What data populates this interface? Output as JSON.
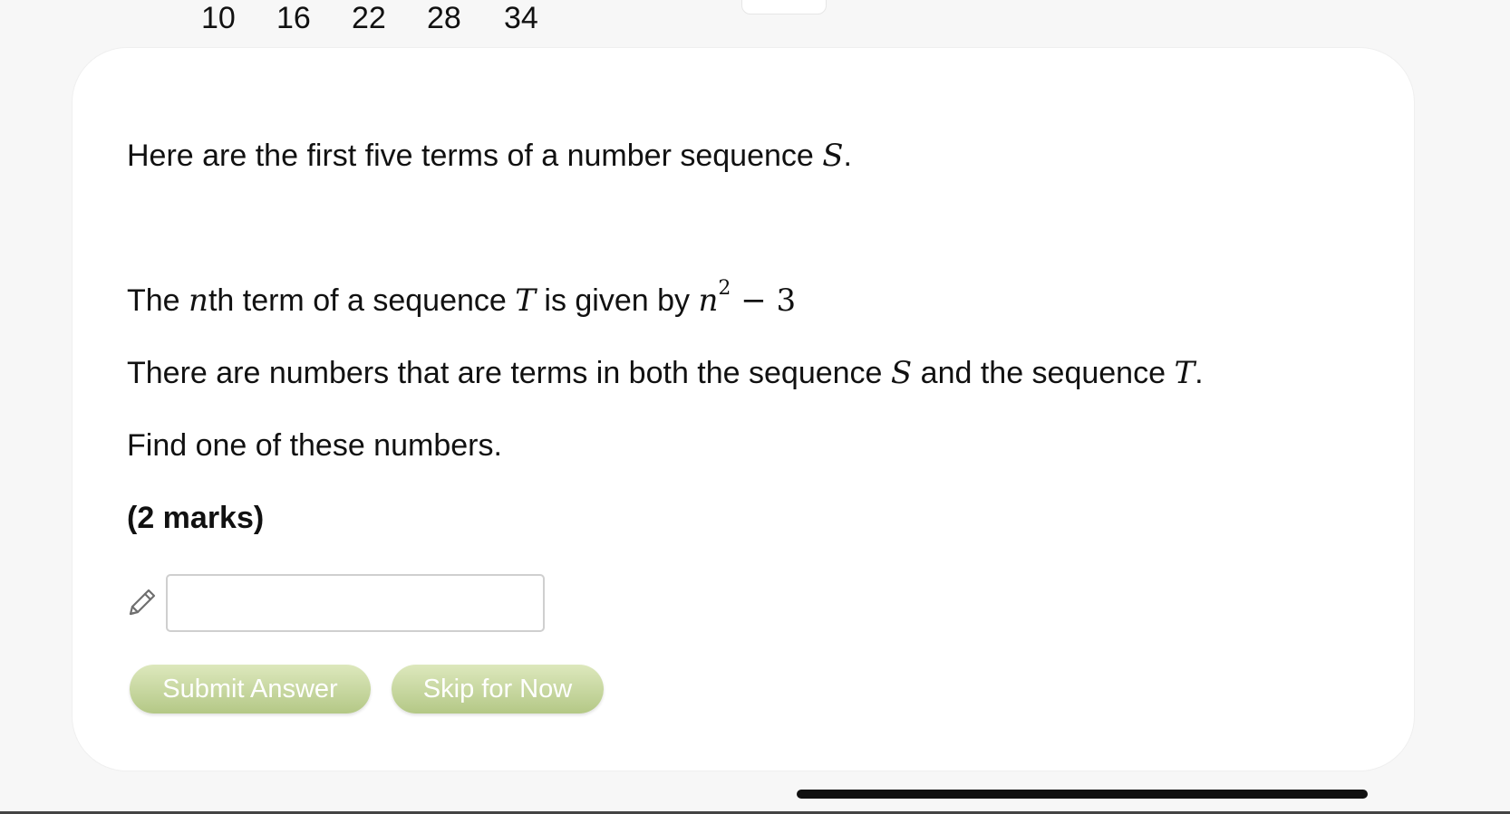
{
  "question": {
    "intro_text": "Here are the first five terms of a number sequence ",
    "intro_var": "S",
    "intro_end": ".",
    "terms": [
      "10",
      "16",
      "22",
      "28",
      "34"
    ],
    "nth_prefix": "The ",
    "nth_var": "n",
    "nth_middle": "th term of a sequence ",
    "nth_seq_var": "T",
    "nth_given": " is given by ",
    "nth_expr_base": "n",
    "nth_expr_exp": "2",
    "nth_expr_rest": " − 3",
    "both_prefix": "There are numbers that are terms in both the sequence ",
    "both_var_s": "S",
    "both_middle": " and the sequence ",
    "both_var_t": "T",
    "both_end": ".",
    "find_text": "Find one of these numbers.",
    "marks": "(2 marks)"
  },
  "answer": {
    "value": "",
    "placeholder": ""
  },
  "buttons": {
    "submit_label": "Submit Answer",
    "skip_label": "Skip for Now"
  },
  "colors": {
    "button_top": "#dde8bd",
    "button_bottom": "#b4c886",
    "card_background": "#ffffff",
    "page_background": "#f7f7f7"
  },
  "icons": {
    "answer_icon": "pencil-icon"
  }
}
